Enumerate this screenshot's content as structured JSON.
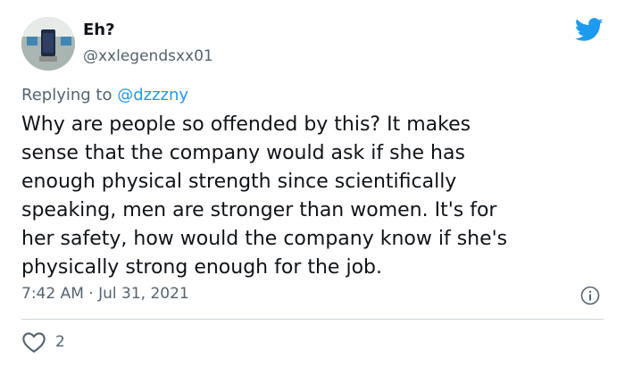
{
  "user": {
    "display_name": "Eh?",
    "handle": "@xxlegendsxx01"
  },
  "reply": {
    "prefix": "Replying to ",
    "mention": "@dzzzny"
  },
  "tweet": {
    "text": "Why are people so offended by this? It makes\nsense that the company would ask if she has\nenough physical strength since scientifically\nspeaking, men are stronger than women. It's for\nher safety, how would the company know if she's\nphysically strong enough for the job.",
    "timestamp": "7:42 AM · Jul 31, 2021",
    "like_count": "2"
  },
  "icons": {
    "brand": "twitter-bird-icon",
    "info": "info-icon",
    "like": "heart-icon"
  },
  "colors": {
    "brand": "#1d9bf0",
    "muted": "#536471",
    "text": "#0f1419"
  }
}
